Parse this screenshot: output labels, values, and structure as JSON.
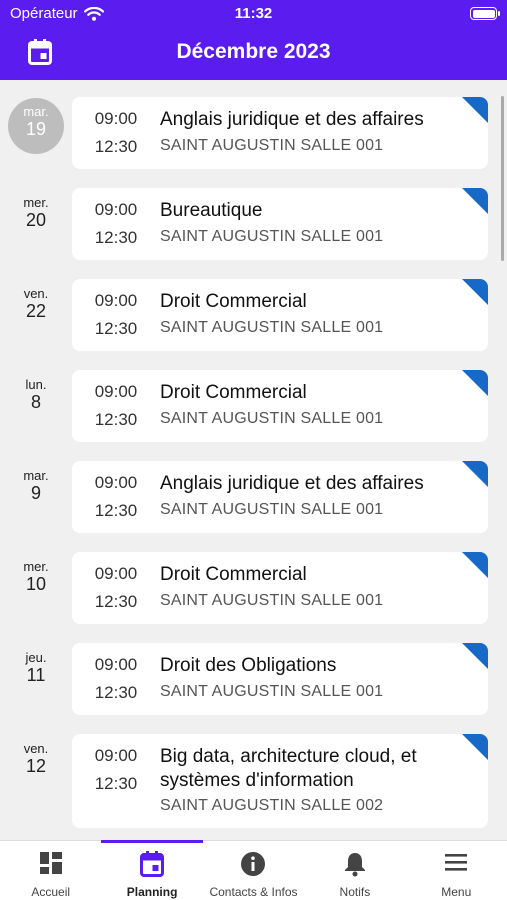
{
  "status_bar": {
    "carrier": "Opérateur",
    "time": "11:32"
  },
  "header": {
    "title": "Décembre 2023"
  },
  "colors": {
    "accent": "#5b1cf0",
    "corner": "#1769c7",
    "today_circle": "#bdbdbd"
  },
  "events": [
    {
      "dow": "mar.",
      "day": "19",
      "start": "09:00",
      "end": "12:30",
      "subject": "Anglais juridique et des affaires",
      "room": "SAINT AUGUSTIN SALLE 001",
      "today": true
    },
    {
      "dow": "mer.",
      "day": "20",
      "start": "09:00",
      "end": "12:30",
      "subject": "Bureautique",
      "room": "SAINT AUGUSTIN SALLE 001"
    },
    {
      "dow": "ven.",
      "day": "22",
      "start": "09:00",
      "end": "12:30",
      "subject": "Droit Commercial",
      "room": "SAINT AUGUSTIN SALLE 001"
    },
    {
      "dow": "lun.",
      "day": "8",
      "start": "09:00",
      "end": "12:30",
      "subject": "Droit Commercial",
      "room": "SAINT AUGUSTIN SALLE 001"
    },
    {
      "dow": "mar.",
      "day": "9",
      "start": "09:00",
      "end": "12:30",
      "subject": "Anglais juridique et des affaires",
      "room": "SAINT AUGUSTIN SALLE 001"
    },
    {
      "dow": "mer.",
      "day": "10",
      "start": "09:00",
      "end": "12:30",
      "subject": "Droit Commercial",
      "room": "SAINT AUGUSTIN SALLE 001"
    },
    {
      "dow": "jeu.",
      "day": "11",
      "start": "09:00",
      "end": "12:30",
      "subject": "Droit des Obligations",
      "room": "SAINT AUGUSTIN SALLE 001"
    },
    {
      "dow": "ven.",
      "day": "12",
      "start": "09:00",
      "end": "12:30",
      "subject": "Big data, architecture cloud, et systèmes d'information",
      "room": "SAINT AUGUSTIN SALLE 002"
    }
  ],
  "tabs": [
    {
      "label": "Accueil",
      "icon": "dashboard-icon"
    },
    {
      "label": "Planning",
      "icon": "calendar-icon",
      "active": true
    },
    {
      "label": "Contacts & Infos",
      "icon": "info-icon"
    },
    {
      "label": "Notifs",
      "icon": "bell-icon"
    },
    {
      "label": "Menu",
      "icon": "hamburger-icon"
    }
  ]
}
